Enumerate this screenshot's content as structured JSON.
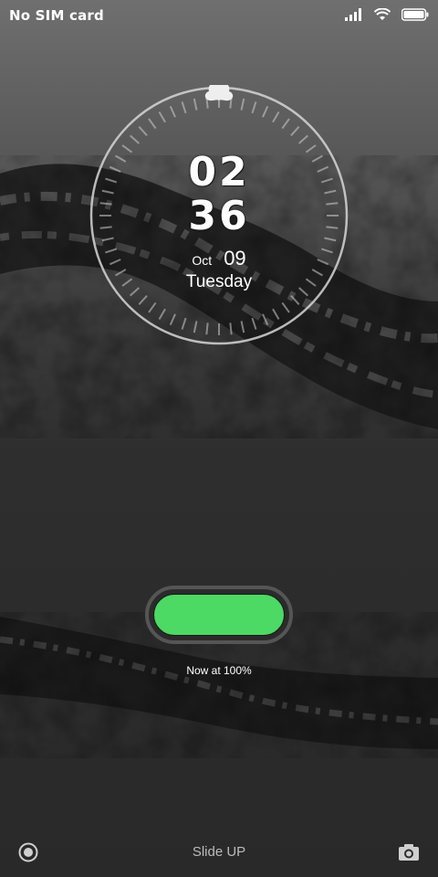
{
  "status_bar": {
    "carrier": "No SIM card",
    "icons": [
      "signal-icon",
      "wifi-icon",
      "battery-icon"
    ]
  },
  "lockscreen": {
    "time": {
      "hours": "02",
      "minutes": "36"
    },
    "date": {
      "month": "Oct",
      "day": "09",
      "weekday": "Tuesday"
    },
    "battery": {
      "level_percent": 100,
      "label": "Now at 100%",
      "fill_color": "#4cd964"
    },
    "bottom": {
      "hint": "Slide UP",
      "left_icon": "target-icon",
      "right_icon": "camera-icon"
    }
  },
  "theme": {
    "accent": "#4cd964",
    "text": "#ffffff"
  }
}
